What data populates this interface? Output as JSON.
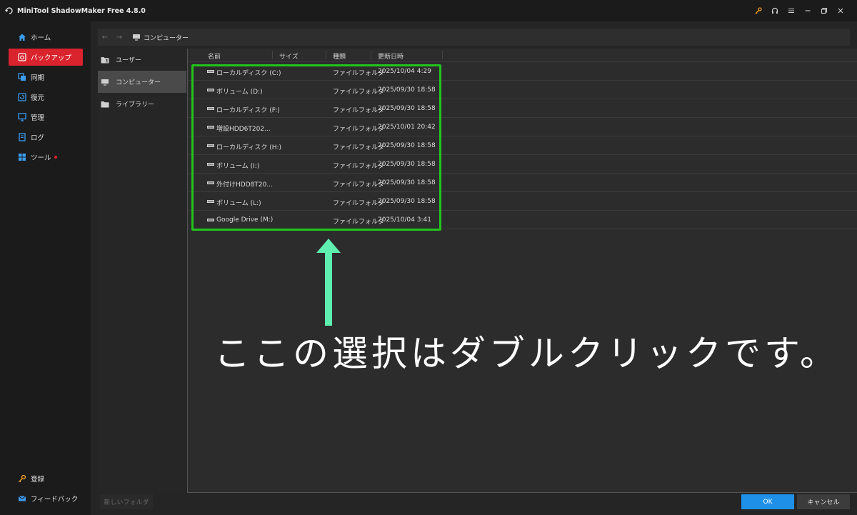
{
  "app": {
    "title": "MiniTool ShadowMaker Free 4.8.0"
  },
  "sidebar": {
    "items": [
      {
        "label": "ホーム",
        "icon": "home-icon"
      },
      {
        "label": "バックアップ",
        "icon": "backup-icon",
        "active": true
      },
      {
        "label": "同期",
        "icon": "sync-icon"
      },
      {
        "label": "復元",
        "icon": "restore-icon"
      },
      {
        "label": "管理",
        "icon": "manage-icon"
      },
      {
        "label": "ログ",
        "icon": "log-icon"
      },
      {
        "label": "ツール",
        "icon": "tools-icon",
        "badge_dot": true
      }
    ],
    "bottom": [
      {
        "label": "登録",
        "icon": "key-icon"
      },
      {
        "label": "フィードバック",
        "icon": "mail-icon"
      }
    ]
  },
  "address_bar": {
    "path": "コンピューター"
  },
  "tree": [
    {
      "label": "ユーザー",
      "icon": "user-folder-icon"
    },
    {
      "label": "コンピューター",
      "icon": "computer-icon",
      "selected": true
    },
    {
      "label": "ライブラリー",
      "icon": "folder-icon"
    }
  ],
  "columns": {
    "name": "名前",
    "size": "サイズ",
    "type": "種類",
    "modified": "更新日時"
  },
  "rows": [
    {
      "name": "ローカルディスク (C:)",
      "type": "ファイルフォルダ",
      "modified": "2025/10/04 4:29"
    },
    {
      "name": "ボリューム (D:)",
      "type": "ファイルフォルダ",
      "modified": "2025/09/30 18:58"
    },
    {
      "name": "ローカルディスク (F:)",
      "type": "ファイルフォルダ",
      "modified": "2025/09/30 18:58"
    },
    {
      "name": "増設HDD6T202...",
      "type": "ファイルフォルダ",
      "modified": "2025/10/01 20:42"
    },
    {
      "name": "ローカルディスク (H:)",
      "type": "ファイルフォルダ",
      "modified": "2025/09/30 18:58"
    },
    {
      "name": "ボリューム (I:)",
      "type": "ファイルフォルダ",
      "modified": "2025/09/30 18:58"
    },
    {
      "name": "外付けHDD8T20...",
      "type": "ファイルフォルダ",
      "modified": "2025/09/30 18:58"
    },
    {
      "name": "ボリューム (L:)",
      "type": "ファイルフォルダ",
      "modified": "2025/09/30 18:58"
    },
    {
      "name": "Google Drive (M:)",
      "type": "ファイルフォルダ",
      "modified": "2025/10/04 3:41"
    }
  ],
  "annotation": {
    "text": "ここの選択はダブルクリックです。"
  },
  "buttons": {
    "new_folder": "新しいフォルダ",
    "ok": "OK",
    "cancel": "キャンセル"
  },
  "colors": {
    "accent_red": "#d9232d",
    "ok_blue": "#1e90e8",
    "highlight_green": "#22c41c",
    "arrow_mint": "#5fefb0"
  }
}
